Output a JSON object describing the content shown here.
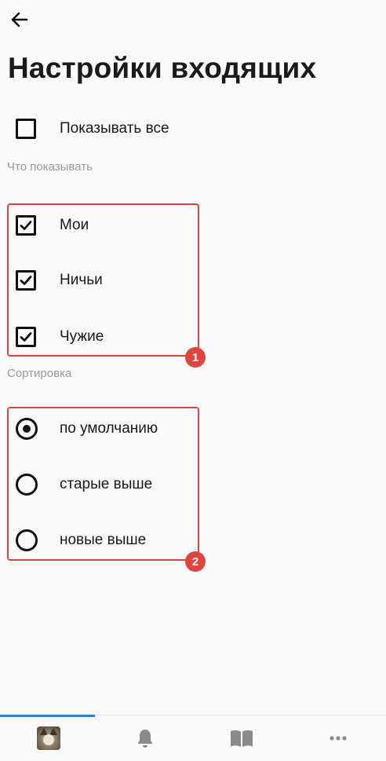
{
  "header": {
    "back_icon": "arrow-left-icon",
    "title": "Настройки входящих"
  },
  "show_all": {
    "label": "Показывать все",
    "checked": false
  },
  "what_to_show": {
    "section_label": "Что показывать",
    "items": [
      {
        "label": "Мои",
        "checked": true
      },
      {
        "label": "Ничьи",
        "checked": true
      },
      {
        "label": "Чужие",
        "checked": true
      }
    ],
    "badge": "1"
  },
  "sorting": {
    "section_label": "Сортировка",
    "options": [
      {
        "label": "по умолчанию",
        "selected": true
      },
      {
        "label": "старые выше",
        "selected": false
      },
      {
        "label": "новые выше",
        "selected": false
      }
    ],
    "badge": "2"
  },
  "bottom_nav": {
    "items": [
      {
        "icon": "avatar-icon",
        "active": true
      },
      {
        "icon": "bell-icon",
        "active": false
      },
      {
        "icon": "book-icon",
        "active": false
      },
      {
        "icon": "more-dots-icon",
        "active": false
      }
    ]
  },
  "colors": {
    "highlight": "#e0443e",
    "active_indicator": "#2b7de1",
    "icon_gray": "#8a8a8a"
  }
}
